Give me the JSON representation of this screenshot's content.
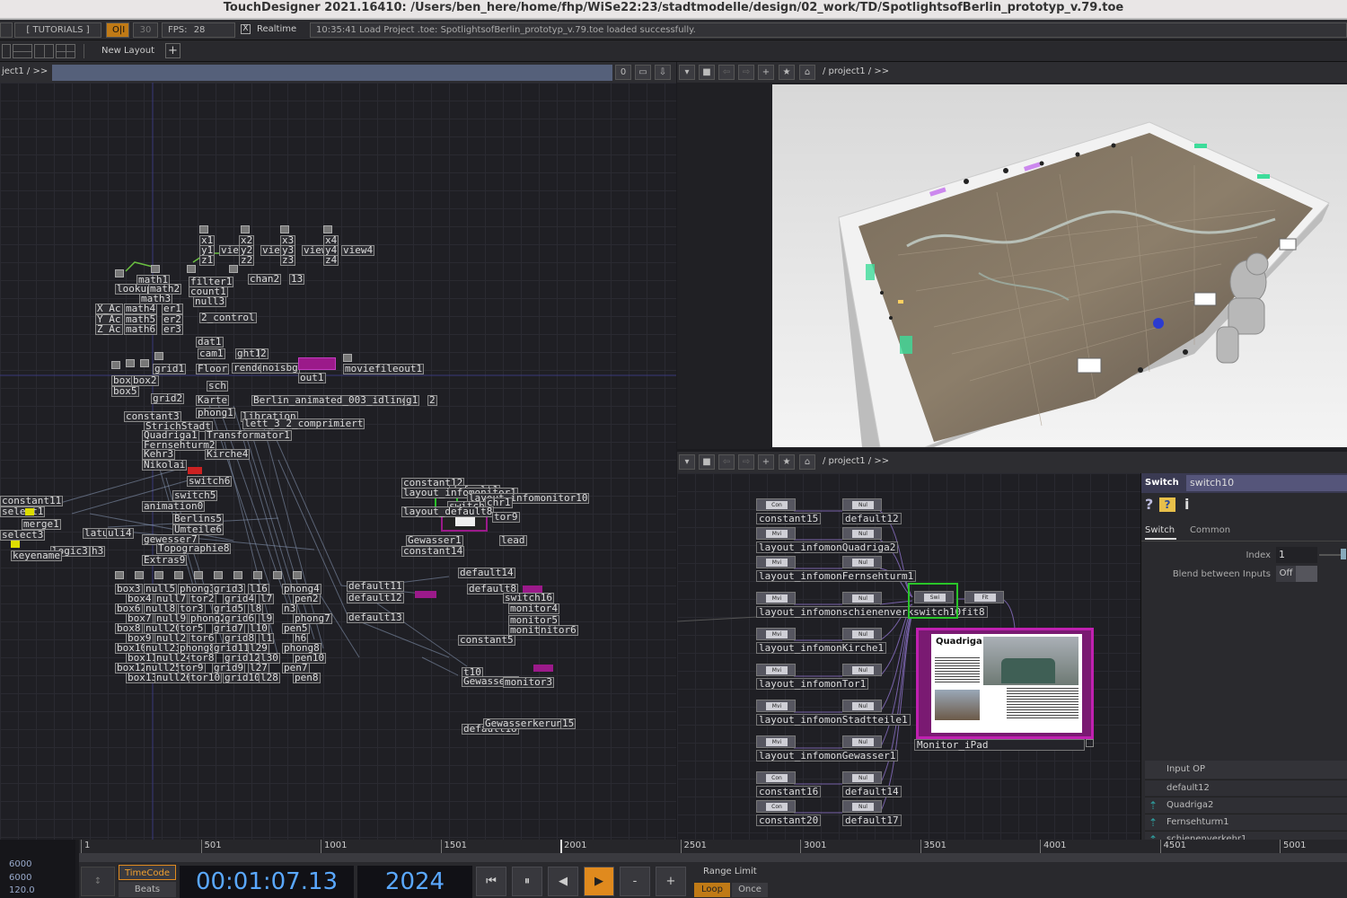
{
  "window": {
    "title": "TouchDesigner 2021.16410: /Users/ben_here/home/fhp/WiSe22:23/stadtmodelle/design/02_work/TD/SpotlightsofBerlin_prototyp_v.79.toe"
  },
  "toolbar": {
    "tutorials": "[ TUTORIALS ]",
    "oi": "O|I",
    "fps_cap": "30",
    "fps_label": "FPS:",
    "fps_value": "28",
    "realtime_check": "X",
    "realtime_label": "Realtime",
    "status": "10:35:41 Load Project .toe: SpotlightsofBerlin_prototyp_v.79.toe loaded successfully."
  },
  "layout_bar": {
    "new_layout": "New Layout",
    "add": "+"
  },
  "network_left": {
    "path": "ject1 / >>",
    "counter": "0"
  },
  "viewer_bar": {
    "path": "/ project1 / >>"
  },
  "network_right_bar": {
    "path": "/ project1 / >>"
  },
  "left_nodes": [
    "x1",
    "x2",
    "x3",
    "x4",
    "y1",
    "view1",
    "y2",
    "view2",
    "y3",
    "view3",
    "y4",
    "view4",
    "z1",
    "z2",
    "z3",
    "z4",
    "math1",
    "filter1",
    "chan2",
    "13",
    "lookup1",
    "math2",
    "count1",
    "math3",
    "null3",
    "X_Ac",
    "math4",
    "er1",
    "Y_Ac",
    "math5",
    "er2",
    "2_control",
    "Z_Ac",
    "math6",
    "er3",
    "dat1",
    "cam1",
    "ght1",
    "2",
    "grid1",
    "Floor",
    "render1",
    "noisbg",
    "moviefileout1",
    "out1",
    "box1",
    "box2",
    "box4",
    "box5",
    "sch",
    "grid2",
    "Karte",
    "phong1",
    "Berlin_animated_003_idling",
    "g1",
    "2",
    "constant3",
    "libration",
    "StrichStadt",
    "lett_3_2_comprimiert",
    "Quadriga1",
    "Transformator1",
    "Fernsehturm2",
    "Kehr3",
    "Kirche4",
    "Nikolai",
    "switch6",
    "switch5",
    "animation0",
    "Berlins5",
    "Umteile6",
    "gewesser7",
    "Topographie8",
    "Extras9",
    "constant11",
    "select1",
    "merge1",
    "select3",
    "latu1",
    "uli4",
    "logic3",
    "h3",
    "keyename"
  ],
  "left_nodes_bottom": [
    "box3",
    "null5",
    "phong3",
    "grid3",
    "l16",
    "phong4",
    "box4",
    "null7",
    "tor2",
    "grid4",
    "l7",
    "pen2",
    "box6",
    "null8",
    "tor3",
    "grid5",
    "l8",
    "n3",
    "box7",
    "null9",
    "phong2",
    "grid6",
    "l9",
    "phong7",
    "box8",
    "null20",
    "tor5",
    "grid7",
    "l10",
    "pen5",
    "box9",
    "null2",
    "tor6",
    "grid8",
    "l1",
    "h6",
    "box10",
    "null23",
    "phong8",
    "grid11",
    "l29",
    "phong8",
    "box11",
    "null24",
    "tor8",
    "grid12",
    "l30",
    "pen10",
    "box12",
    "null25",
    "tor9",
    "grid9",
    "l27",
    "pen7",
    "box13",
    "null26",
    "tor10",
    "grid10",
    "l28",
    "pen8"
  ],
  "mid_nodes": [
    "constant12",
    "default1",
    "layout_infomonitor1",
    "layout_infomonitor10",
    "switch1",
    "chr1",
    "layout_default8",
    "Gewasser1",
    "lead",
    "tor9",
    "constant14",
    "default11",
    "default12",
    "default13",
    "default14",
    "default8",
    "switch16",
    "monitor4",
    "monitor5",
    "monitor7",
    "nitor6",
    "constant5",
    "t10",
    "Gewasser2",
    "monitor3",
    "default16",
    "Gewasserkerung2",
    "15"
  ],
  "viewer": {
    "note": "3D model table with map of Berlin"
  },
  "right_nodes": [
    {
      "row": 0,
      "a_chip": "Con",
      "a_label": "constant15",
      "b_chip": "Nul",
      "b_label": "default12"
    },
    {
      "row": 1,
      "a_chip": "Mvi",
      "a_label": "layout_infomonQuadriga2",
      "b_chip": "Nul",
      "b_label": ""
    },
    {
      "row": 2,
      "a_chip": "Mvi",
      "a_label": "layout_infomonFernsehturm1",
      "b_chip": "Nul",
      "b_label": ""
    },
    {
      "row": 3,
      "a_chip": "Mvi",
      "a_label": "layout_infomonschienenverkswitch10fit8",
      "b_chip": "Nul",
      "b_label": ""
    },
    {
      "row": 4,
      "a_chip": "Mvi",
      "a_label": "layout_infomonKirche1",
      "b_chip": "Nul",
      "b_label": ""
    },
    {
      "row": 5,
      "a_chip": "Mvi",
      "a_label": "layout_infomonTor1",
      "b_chip": "Nul",
      "b_label": ""
    },
    {
      "row": 6,
      "a_chip": "Mvi",
      "a_label": "layout_infomonStadtteile1",
      "b_chip": "Nul",
      "b_label": ""
    },
    {
      "row": 7,
      "a_chip": "Mvi",
      "a_label": "layout_infomonGewasser1",
      "b_chip": "Nul",
      "b_label": ""
    },
    {
      "row": 8,
      "a_chip": "Con",
      "a_label": "constant16",
      "b_chip": "Nul",
      "b_label": "default14"
    },
    {
      "row": 9,
      "a_chip": "Con",
      "a_label": "constant20",
      "b_chip": "Nul",
      "b_label": "default17"
    }
  ],
  "switch_node": {
    "chip": "Swi",
    "fit_chip": "Fit"
  },
  "monitor": {
    "heading": "Quadriga",
    "label": "Monitor_iPad"
  },
  "params": {
    "type": "Switch",
    "name": "switch10",
    "help": "?",
    "python_help": "?",
    "info": "i",
    "tabs": [
      "Switch",
      "Common"
    ],
    "index_label": "Index",
    "index_value": "1",
    "blend_label": "Blend between Inputs",
    "blend_value": "Off",
    "input_header": "Input OP",
    "inputs": [
      "default12",
      "Quadriga2",
      "Fernsehturm1",
      "schienenverkehr1"
    ]
  },
  "timeline": {
    "ticks": [
      "1",
      "501",
      "1001",
      "1501",
      "2001",
      "2501",
      "3001",
      "3501",
      "4001",
      "4501",
      "5001"
    ]
  },
  "left_info": [
    "6000",
    "6000",
    "120.0"
  ],
  "transport": {
    "timecode_btn": "TimeCode",
    "beats_btn": "Beats",
    "time": "00:01:07.13",
    "frame": "2024",
    "btn_start": "⏮",
    "btn_pause": "⏸",
    "btn_back": "◀",
    "btn_play": "▶",
    "btn_minus": "-",
    "btn_plus": "+",
    "range_label": "Range Limit",
    "loop": "Loop",
    "once": "Once"
  },
  "colors": {
    "accent_orange": "#e08a1e",
    "accent_blue": "#5aa8ff",
    "selected_green": "#29c429",
    "magenta": "#9b1a8a"
  }
}
